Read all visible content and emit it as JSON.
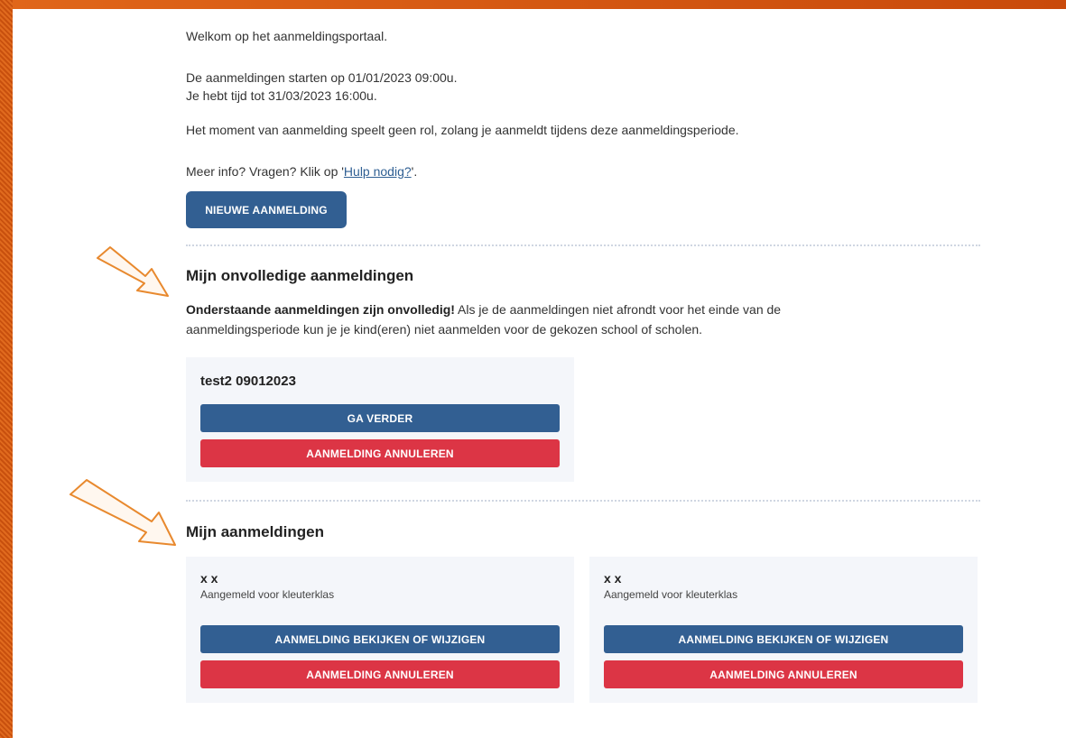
{
  "intro": {
    "welcome": "Welkom op het aanmeldingsportaal.",
    "start_line": "De aanmeldingen starten op 01/01/2023 09:00u.",
    "end_line": "Je hebt tijd tot 31/03/2023 16:00u.",
    "moment_line": "Het moment van aanmelding speelt geen rol, zolang je aanmeldt tijdens deze aanmeldingsperiode.",
    "more_prefix": "Meer info? Vragen? Klik op '",
    "help_link": "Hulp nodig?",
    "more_suffix": "'."
  },
  "new_button": "NIEUWE AANMELDING",
  "incomplete": {
    "title": "Mijn onvolledige aanmeldingen",
    "warning_bold": "Onderstaande aanmeldingen zijn onvolledig!",
    "warning_text": " Als je de aanmeldingen niet afrondt voor het einde van de aanmeldingsperiode kun je je kind(eren) niet aanmelden voor de gekozen school of scholen.",
    "card": {
      "name": "test2 09012023",
      "continue_label": "GA VERDER",
      "cancel_label": "AANMELDING ANNULEREN"
    }
  },
  "registrations": {
    "title": "Mijn aanmeldingen",
    "cards": [
      {
        "name": "x x",
        "subtitle": "Aangemeld voor kleuterklas",
        "view_label": "AANMELDING BEKIJKEN OF WIJZIGEN",
        "cancel_label": "AANMELDING ANNULEREN"
      },
      {
        "name": "x x",
        "subtitle": "Aangemeld voor kleuterklas",
        "view_label": "AANMELDING BEKIJKEN OF WIJZIGEN",
        "cancel_label": "AANMELDING ANNULEREN"
      }
    ]
  },
  "colors": {
    "primary": "#325f92",
    "danger": "#dc3545",
    "frame": "#d9560f",
    "arrow_outline": "#e8892e"
  }
}
